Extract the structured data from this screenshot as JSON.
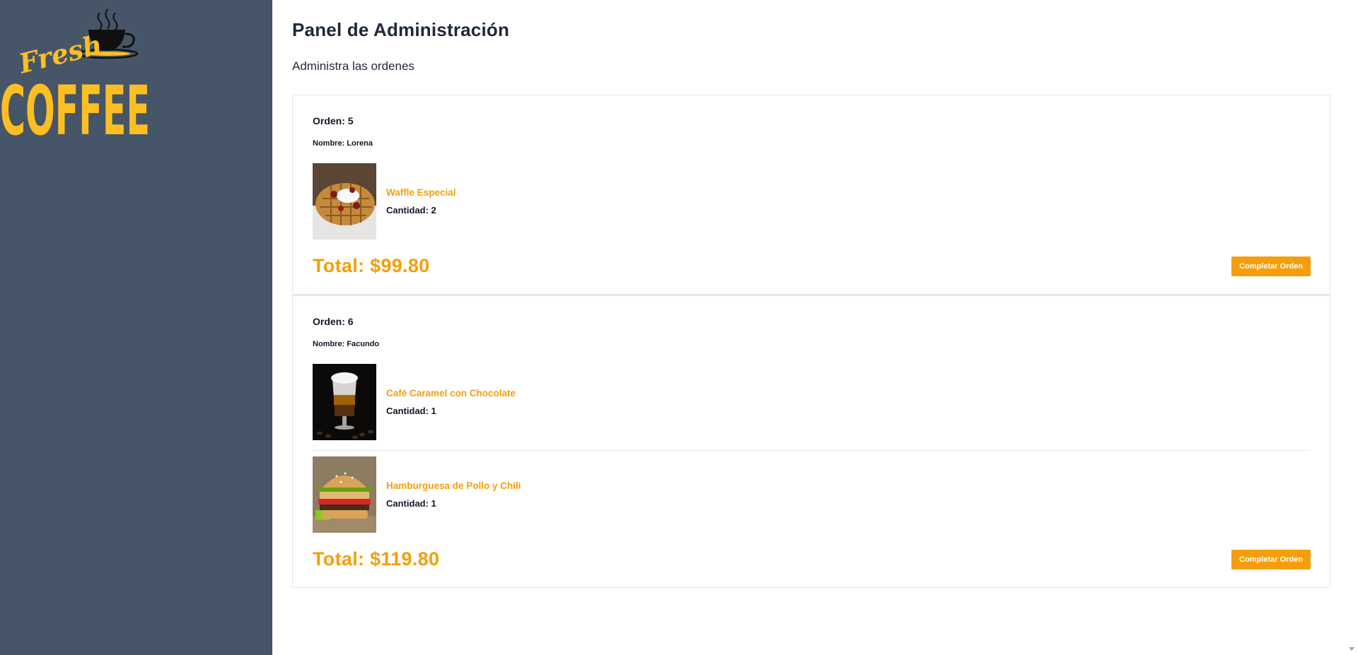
{
  "brand": {
    "logo_word_small": "Fresh",
    "logo_word_large": "COFFEE",
    "colors": {
      "sidebar": "#475569",
      "accent": "#f59e0b",
      "logo": "#fbbf24"
    }
  },
  "header": {
    "title": "Panel de Administración",
    "subtitle": "Administra las ordenes"
  },
  "orders": [
    {
      "number_label": "Orden: 5",
      "name_label": "Nombre: Lorena",
      "items": [
        {
          "name": "Waffle Especial",
          "qty_label": "Cantidad: 2",
          "image": "waffle-image"
        }
      ],
      "total_label": "Total: $99.80",
      "button_label": "Completar Orden"
    },
    {
      "number_label": "Orden: 6",
      "name_label": "Nombre: Facundo",
      "items": [
        {
          "name": "Café Caramel con Chocolate",
          "qty_label": "Cantidad: 1",
          "image": "latte-image"
        },
        {
          "name": "Hamburguesa de Pollo y Chili",
          "qty_label": "Cantidad: 1",
          "image": "burger-image"
        }
      ],
      "total_label": "Total: $119.80",
      "button_label": "Completar Orden"
    }
  ]
}
